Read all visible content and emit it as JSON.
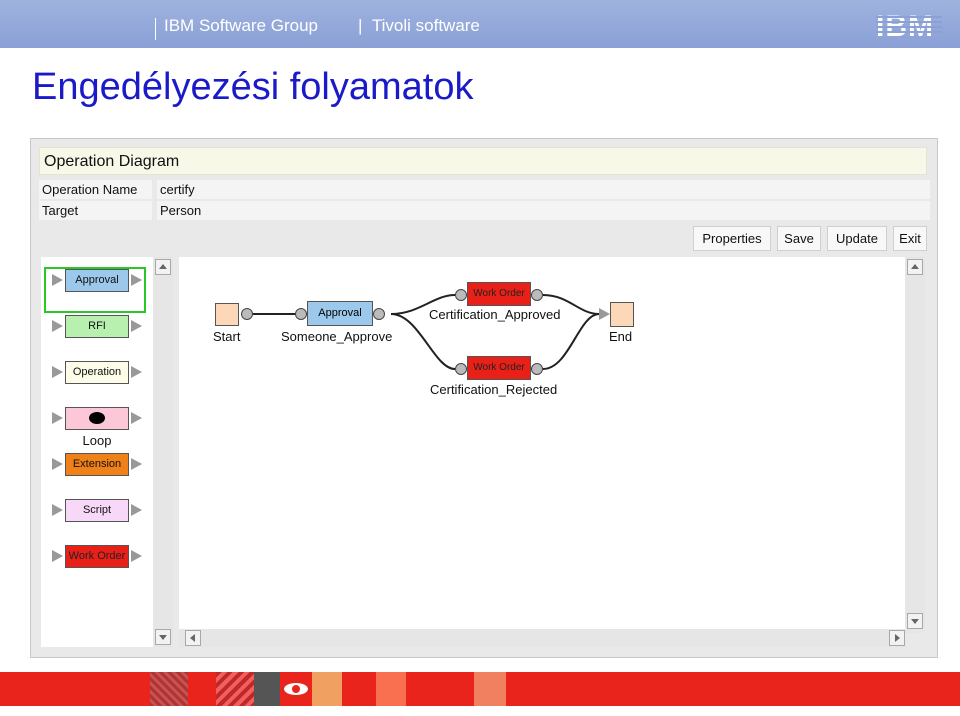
{
  "header": {
    "group": "IBM Software Group",
    "divider": "|",
    "product": "Tivoli software",
    "logo": "IBM"
  },
  "page": {
    "title": "Engedélyezési folyamatok"
  },
  "app": {
    "title": "Operation Diagram",
    "fields": [
      {
        "label": "Operation Name",
        "value": "certify"
      },
      {
        "label": "Target",
        "value": "Person"
      }
    ],
    "buttons": {
      "properties": "Properties",
      "save": "Save",
      "update": "Update",
      "exit": "Exit"
    }
  },
  "palette": {
    "items": [
      {
        "label": "Approval",
        "color": "#9cc8ec",
        "selected": true
      },
      {
        "label": "RFI",
        "color": "#b8f0b0"
      },
      {
        "label": "Operation",
        "color": "#fcfce8"
      },
      {
        "label": "Loop",
        "color": "#fcc8d8",
        "icon": "black-dot-icon"
      },
      {
        "label": "Extension",
        "color": "#f08018"
      },
      {
        "label": "Script",
        "color": "#f8d8f8"
      },
      {
        "label": "Work Order",
        "color": "#e82018"
      }
    ]
  },
  "diagram": {
    "start": "Start",
    "end": "End",
    "approval": {
      "box": "Approval",
      "label": "Someone_Approve"
    },
    "approved": {
      "box": "Work Order",
      "label": "Certification_Approved"
    },
    "rejected": {
      "box": "Work Order",
      "label": "Certification_Rejected"
    }
  },
  "colors": {
    "accent": "#1a1ac8",
    "header": "#8aa0d6",
    "footer": "#e8241c",
    "selection": "#28c828"
  }
}
